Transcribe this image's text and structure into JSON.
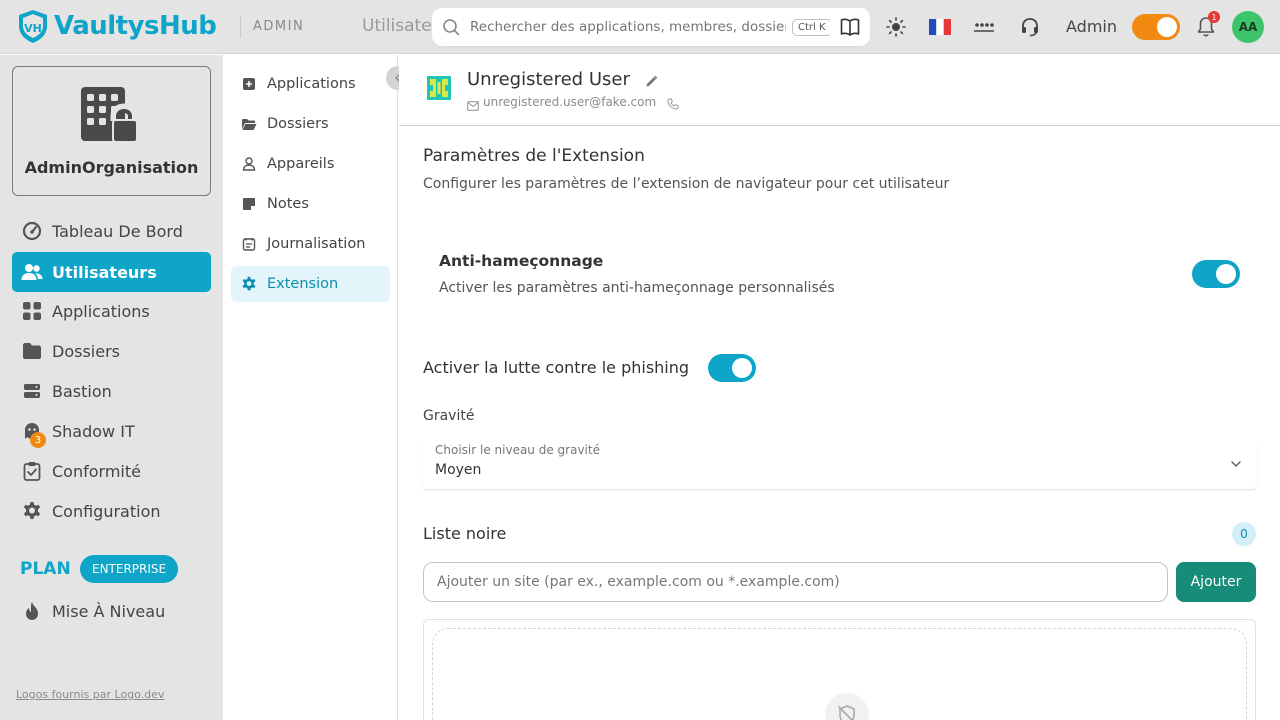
{
  "topbar": {
    "brand": "VaultysHub",
    "section": "ADMIN",
    "breadcrumb": "Utilisateurs",
    "search_placeholder": "Rechercher des applications, membres, dossiers...",
    "search_shortcut": "Ctrl K",
    "user_label": "Admin",
    "notification_count": "1",
    "avatar_initials": "AA",
    "language_flag": "🇫🇷"
  },
  "sidebar": {
    "org_name": "AdminOrganisation",
    "items": [
      {
        "label": "Tableau De Bord",
        "icon": "dashboard-icon"
      },
      {
        "label": "Utilisateurs",
        "icon": "users-icon",
        "active": true
      },
      {
        "label": "Applications",
        "icon": "apps-grid-icon"
      },
      {
        "label": "Dossiers",
        "icon": "folder-icon"
      },
      {
        "label": "Bastion",
        "icon": "server-icon"
      },
      {
        "label": "Shadow IT",
        "icon": "ghost-icon",
        "badge": "3"
      },
      {
        "label": "Conformité",
        "icon": "clipboard-check-icon"
      },
      {
        "label": "Configuration",
        "icon": "gear-icon"
      }
    ],
    "plan_label": "PLAN",
    "plan_value": "ENTERPRISE",
    "upgrade_label": "Mise À Niveau",
    "footer_link": "Logos fournis par Logo.dev"
  },
  "subnav": {
    "items": [
      {
        "label": "Applications",
        "icon": "app-icon"
      },
      {
        "label": "Dossiers",
        "icon": "folder-open-icon"
      },
      {
        "label": "Appareils",
        "icon": "device-user-icon"
      },
      {
        "label": "Notes",
        "icon": "note-icon"
      },
      {
        "label": "Journalisation",
        "icon": "log-icon"
      },
      {
        "label": "Extension",
        "icon": "gear-icon",
        "active": true
      }
    ]
  },
  "user": {
    "name": "Unregistered User",
    "email": "unregistered.user@fake.com"
  },
  "extension": {
    "title": "Paramètres de l'Extension",
    "description": "Configurer les paramètres de l’extension de navigateur pour cet utilisateur",
    "anti_title": "Anti-hameçonnage",
    "anti_description": "Activer les paramètres anti-hameçonnage personnalisés",
    "anti_enabled": true,
    "phishing_label": "Activer la lutte contre le phishing",
    "phishing_enabled": true,
    "gravity_label": "Gravité",
    "gravity_select_label": "Choisir le niveau de gravité",
    "gravity_value": "Moyen",
    "blacklist_title": "Liste noire",
    "blacklist_count": "0",
    "site_placeholder": "Ajouter un site (par ex., example.com ou *.example.com)",
    "add_button": "Ajouter"
  },
  "colors": {
    "accent": "#0ea5c8",
    "add_button": "#178c78",
    "toggle_theme": "#f28a12",
    "badge": "#e53935"
  }
}
